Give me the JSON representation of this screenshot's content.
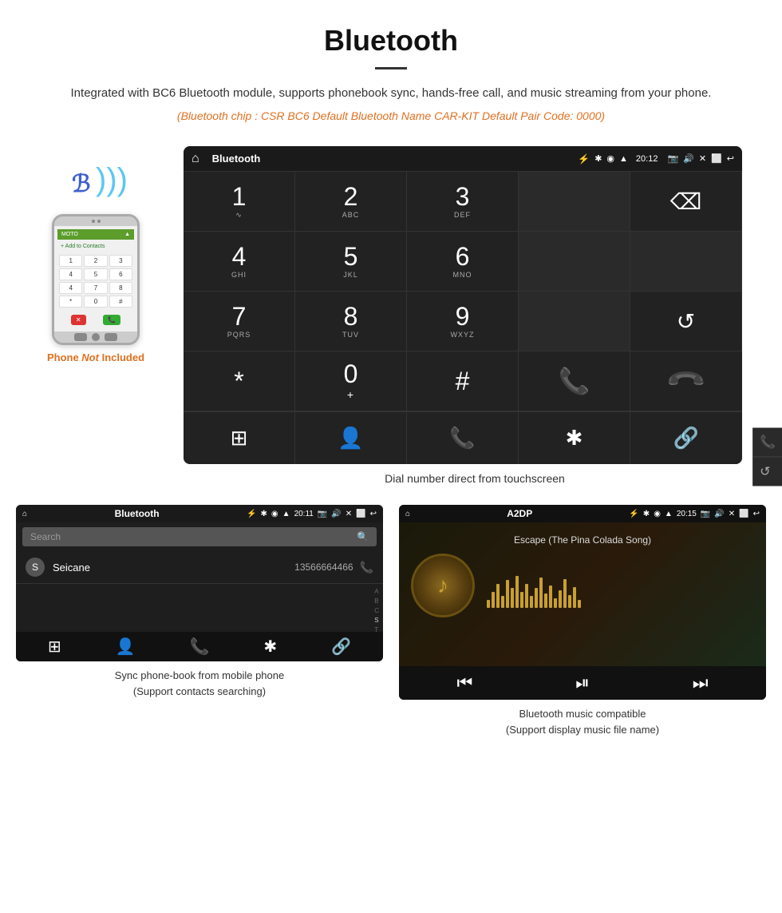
{
  "header": {
    "title": "Bluetooth",
    "description": "Integrated with BC6 Bluetooth module, supports phonebook sync, hands-free call, and music streaming from your phone.",
    "specs": "(Bluetooth chip : CSR BC6    Default Bluetooth Name CAR-KIT    Default Pair Code: 0000)"
  },
  "phone_label": {
    "not": "Not",
    "rest": " Included",
    "full": "Phone Not Included"
  },
  "dial_screen": {
    "status_bar": {
      "home_icon": "⌂",
      "title": "Bluetooth",
      "usb_icon": "⚡",
      "time": "20:12",
      "camera_icon": "📷",
      "volume_icon": "🔊",
      "close_icon": "✕",
      "screen_icon": "⬜",
      "back_icon": "↩"
    },
    "keypad": [
      {
        "number": "1",
        "sub": "∿",
        "col": 1
      },
      {
        "number": "2",
        "sub": "ABC",
        "col": 2
      },
      {
        "number": "3",
        "sub": "DEF",
        "col": 3
      },
      {
        "number": "",
        "sub": "",
        "col": 4,
        "empty": true
      },
      {
        "number": "⌫",
        "sub": "",
        "col": 5,
        "action": "backspace"
      },
      {
        "number": "4",
        "sub": "GHI",
        "col": 1
      },
      {
        "number": "5",
        "sub": "JKL",
        "col": 2
      },
      {
        "number": "6",
        "sub": "MNO",
        "col": 3
      },
      {
        "number": "",
        "sub": "",
        "col": 4,
        "empty": true
      },
      {
        "number": "",
        "sub": "",
        "col": 5,
        "empty": true
      },
      {
        "number": "7",
        "sub": "PQRS",
        "col": 1
      },
      {
        "number": "8",
        "sub": "TUV",
        "col": 2
      },
      {
        "number": "9",
        "sub": "WXYZ",
        "col": 3
      },
      {
        "number": "",
        "sub": "",
        "col": 4,
        "empty": true
      },
      {
        "number": "↺",
        "sub": "",
        "col": 5,
        "action": "refresh"
      },
      {
        "number": "*",
        "sub": "",
        "col": 1
      },
      {
        "number": "0",
        "sub": "+",
        "col": 2
      },
      {
        "number": "#",
        "sub": "",
        "col": 3
      },
      {
        "number": "📞",
        "sub": "",
        "col": 4,
        "action": "call"
      },
      {
        "number": "📵",
        "sub": "",
        "col": 5,
        "action": "hangup"
      }
    ],
    "bottom_bar": [
      "⊞",
      "👤",
      "📞",
      "✱",
      "🔗"
    ]
  },
  "dial_caption": "Dial number direct from touchscreen",
  "contacts_screen": {
    "status": {
      "home": "⌂",
      "title": "Bluetooth",
      "usb": "⚡",
      "time": "20:11",
      "right": "📷 🔊 ✕ ⬜ ↩"
    },
    "search_placeholder": "Search",
    "contacts": [
      {
        "initial": "S",
        "name": "Seicane",
        "phone": "13566664466"
      }
    ],
    "bottom_icons": [
      "⊞",
      "👤",
      "📞",
      "✱",
      "🔗"
    ]
  },
  "music_screen": {
    "status": {
      "home": "⌂",
      "title": "A2DP",
      "usb": "⚡",
      "time": "20:15",
      "right": "📷 🔊 ✕ ⬜ ↩"
    },
    "song_title": "Escape (The Pina Colada Song)",
    "controls": [
      "⏮",
      "⏯",
      "⏭"
    ]
  },
  "captions": {
    "contacts": "Sync phone-book from mobile phone\n(Support contacts searching)",
    "music": "Bluetooth music compatible\n(Support display music file name)"
  },
  "colors": {
    "orange": "#e07020",
    "green": "#4caf50",
    "red": "#f44336",
    "blue": "#4a6fd8",
    "light_blue": "#5bc8f0"
  }
}
